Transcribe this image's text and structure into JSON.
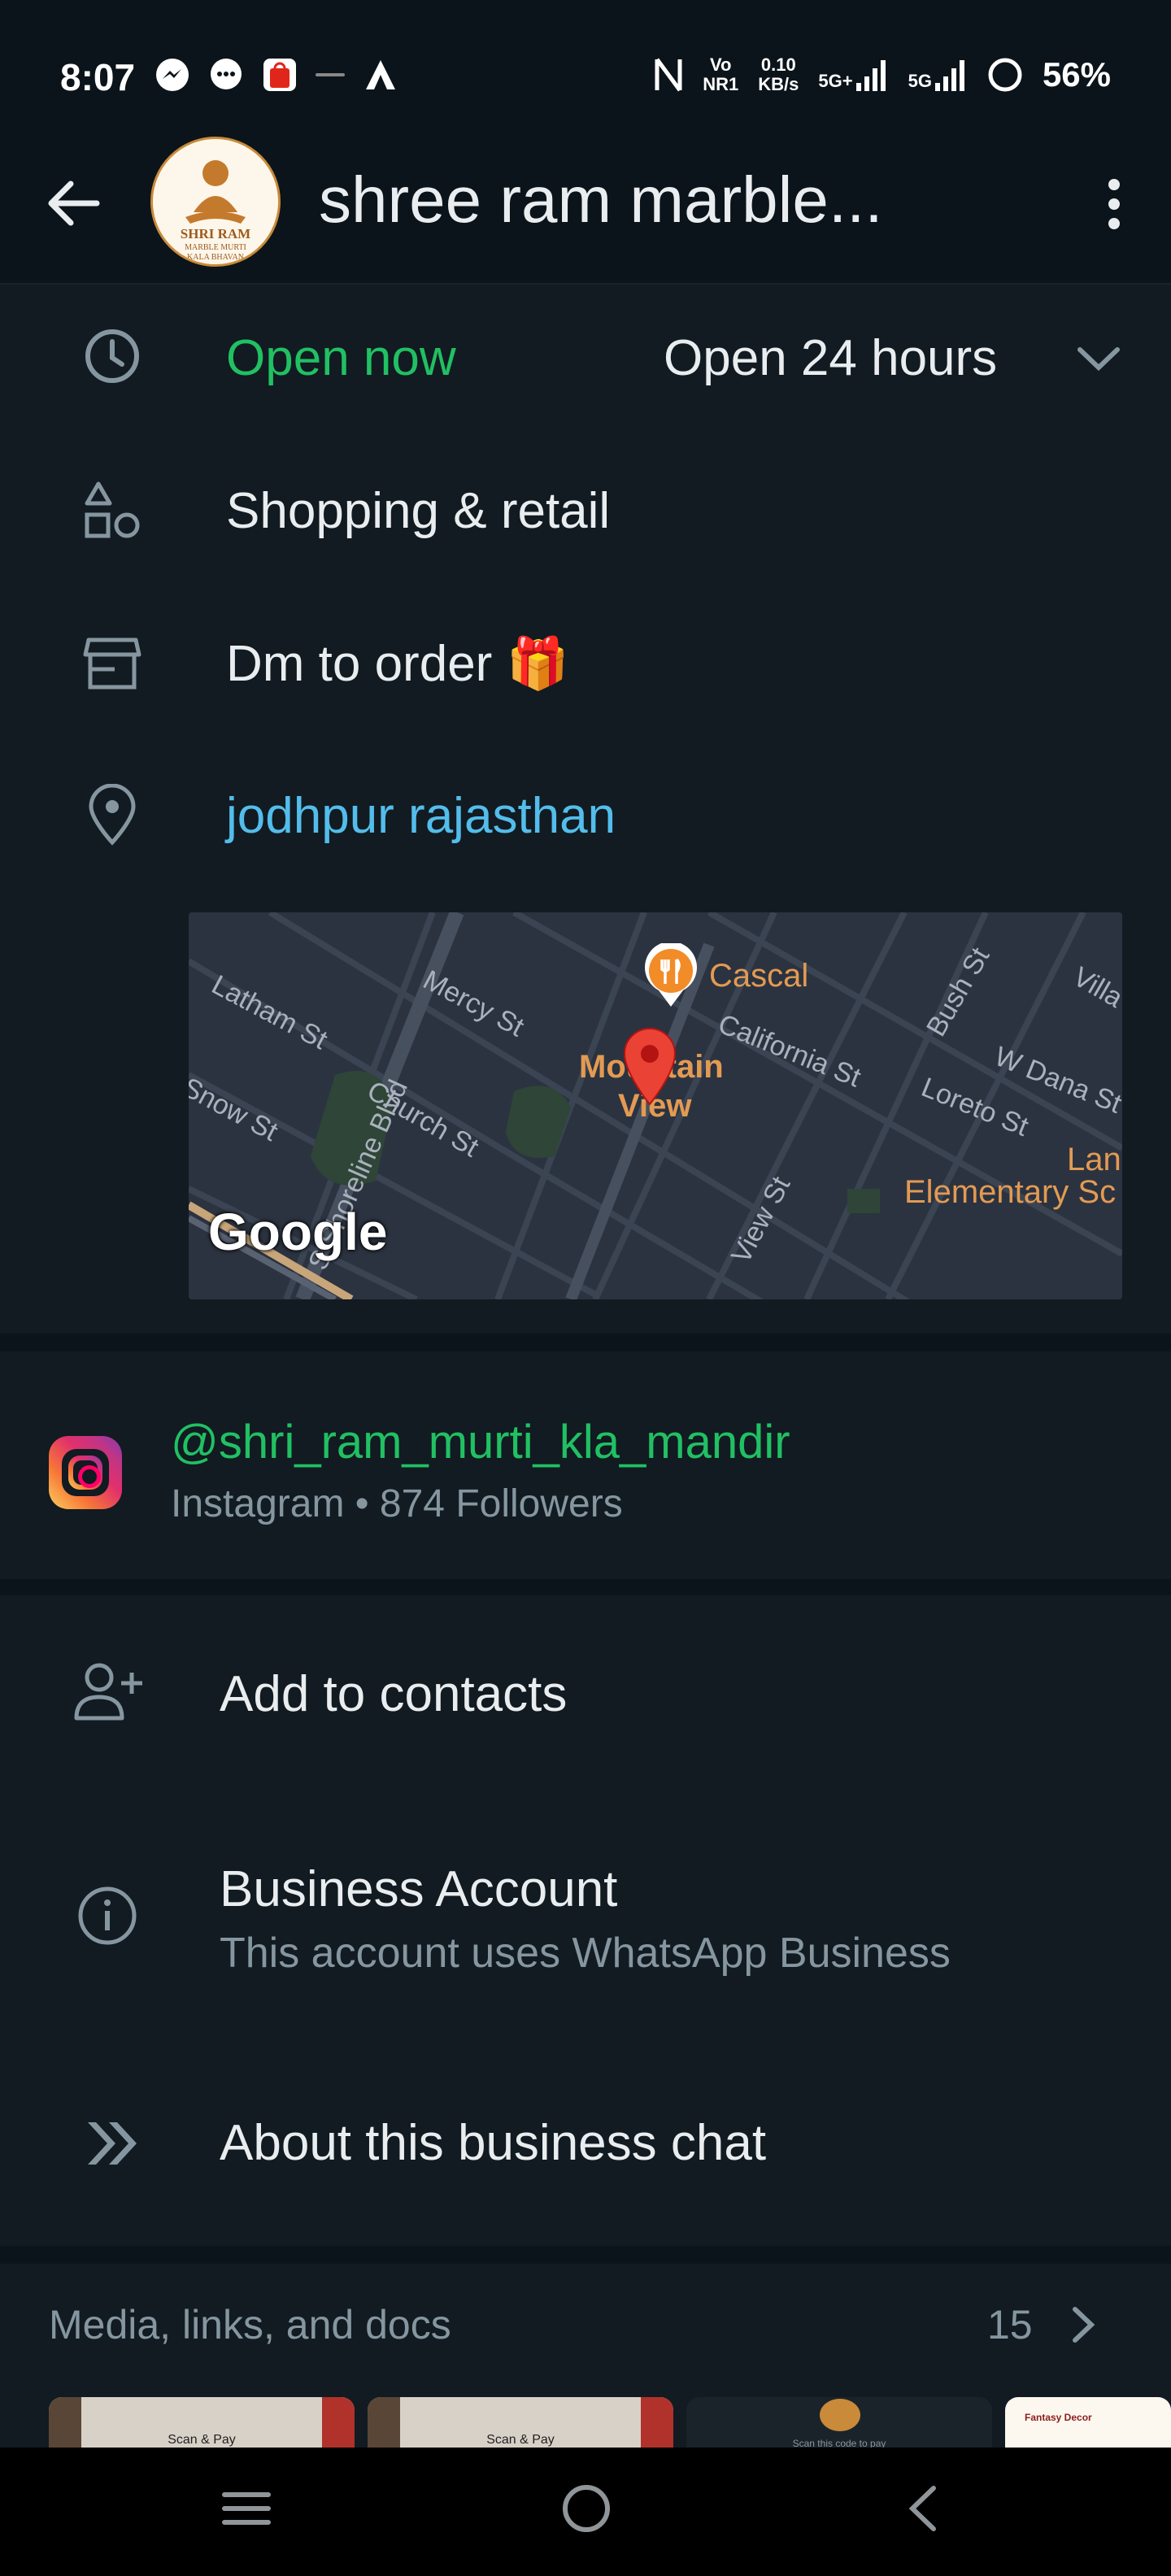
{
  "status_bar": {
    "time": "8:07",
    "network_top": "Vo",
    "network_bottom": "NR1",
    "speed_top": "0.10",
    "speed_bottom": "KB/s",
    "sim1": "5G+",
    "sim2": "5G",
    "battery": "56%"
  },
  "header": {
    "title": "shree ram marble...",
    "avatar_line1": "SHRI RAM",
    "avatar_line2": "MARBLE MURTI",
    "avatar_line3": "KALA BHAVAN"
  },
  "business_info": {
    "hours_status": "Open now",
    "hours_detail": "Open 24 hours",
    "category": "Shopping & retail",
    "description": "Dm to order 🎁",
    "location": "jodhpur rajasthan"
  },
  "map": {
    "labels": {
      "latham": "Latham St",
      "mercy": "Mercy St",
      "shoreline": "S Shoreline Blvd",
      "church": "Church St",
      "snow": "Snow St",
      "california": "California St",
      "bush": "Bush St",
      "wdana": "W Dana St",
      "loreto": "Loreto St",
      "view": "View St",
      "ville": "Villa"
    },
    "poi_cafe": "Cascal",
    "poi_city_1": "Mountain",
    "poi_city_2": "View",
    "poi_school_1": "Lan",
    "poi_school_2": "Elementary Sc",
    "watermark": "Google"
  },
  "instagram": {
    "handle": "@shri_ram_murti_kla_mandir",
    "subtitle": "Instagram • 874 Followers"
  },
  "actions": {
    "add_contact": "Add to contacts",
    "business_title": "Business Account",
    "business_subtitle": "This account uses WhatsApp Business",
    "about": "About this business chat"
  },
  "media": {
    "title": "Media, links, and docs",
    "count": "15",
    "thumb_caption": "Scan & Pay",
    "thumb_caption_3": "Scan this code to pay",
    "thumb_caption_4": "Fantasy Decor"
  },
  "colors": {
    "background": "#0b141a",
    "card": "#111b21",
    "accent_green": "#21c063",
    "link_blue": "#53bdeb"
  }
}
